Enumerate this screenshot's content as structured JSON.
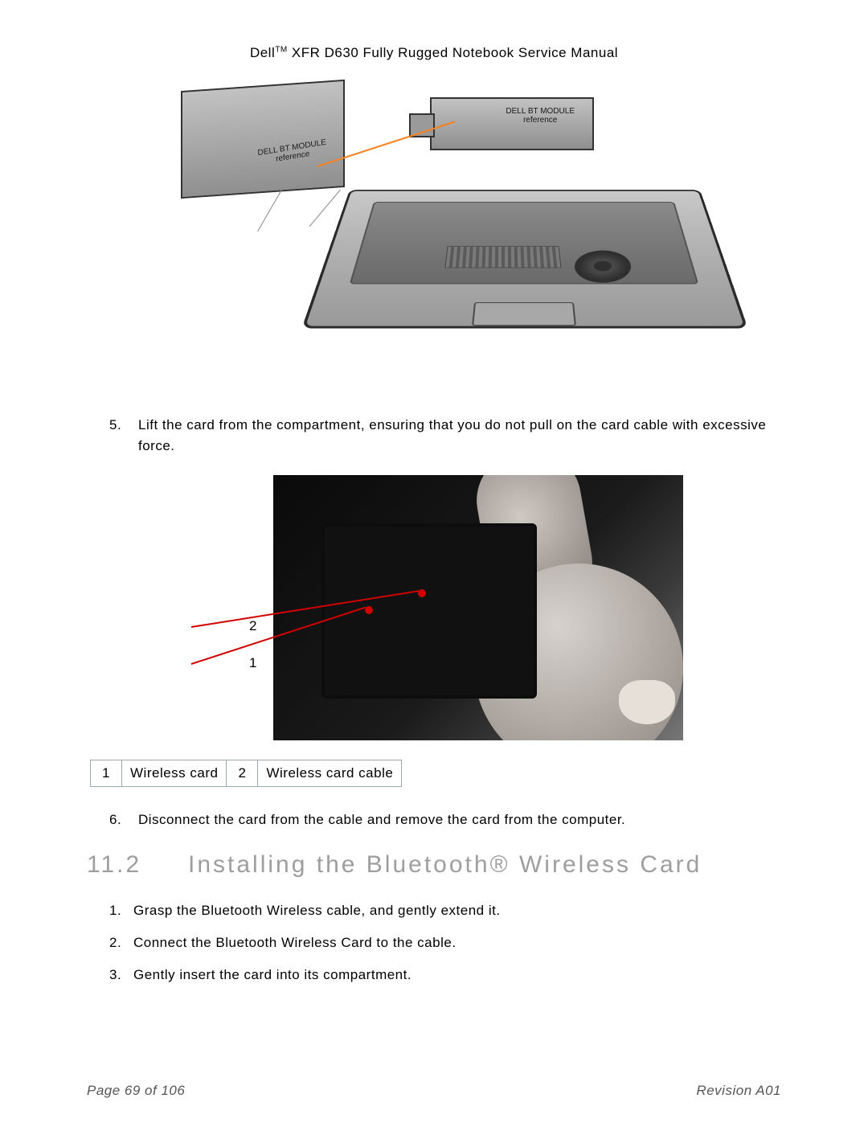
{
  "header": {
    "brand": "Dell",
    "tm": "TM",
    "title_rest": " XFR D630 Fully Rugged Notebook Service Manual"
  },
  "figure1": {
    "callout_tl_line1": "DELL  BT  MODULE",
    "callout_tl_line2": "reference",
    "callout_tr_line1": "DELL  BT  MODULE",
    "callout_tr_line2": "reference"
  },
  "step5": {
    "num": "5.",
    "text": "Lift the card from the compartment, ensuring that you do not pull on the card cable with excessive force."
  },
  "figure2": {
    "label_1": "1",
    "label_2": "2"
  },
  "legend": {
    "n1": "1",
    "t1": "Wireless card",
    "n2": "2",
    "t2": "Wireless card cable"
  },
  "step6": {
    "num": "6.",
    "text": "Disconnect the card from the cable and remove the card from the computer."
  },
  "section": {
    "num": "11.2",
    "title": "Installing the Bluetooth® Wireless Card"
  },
  "steps2": {
    "s1n": "1.",
    "s1": "Grasp the Bluetooth Wireless cable, and gently extend it.",
    "s2n": "2.",
    "s2": "Connect the Bluetooth Wireless Card to the cable.",
    "s3n": "3.",
    "s3": "Gently insert the card into its compartment."
  },
  "footer": {
    "page": "Page 69 of 106",
    "rev": "Revision A01"
  }
}
